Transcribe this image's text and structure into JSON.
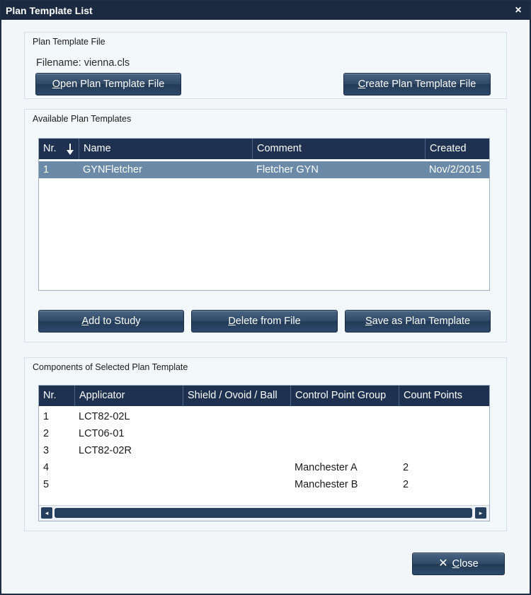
{
  "window": {
    "title": "Plan Template List",
    "close_glyph": "×"
  },
  "file_section": {
    "title": "Plan Template File",
    "filename_label": "Filename: vienna.cls",
    "open_button": {
      "mnemonic": "O",
      "rest": "pen Plan Template File"
    },
    "create_button": {
      "mnemonic": "C",
      "rest": "reate Plan Template File"
    }
  },
  "available_section": {
    "title": "Available Plan Templates",
    "columns": [
      "Nr.",
      "Name",
      "Comment",
      "Created"
    ],
    "sort_icon": "sort-descending-arrow",
    "rows": [
      {
        "nr": "1",
        "name": "GYNFletcher",
        "comment": "Fletcher GYN",
        "created": "Nov/2/2015",
        "selected": true
      }
    ],
    "add_button": {
      "mnemonic": "A",
      "rest": "dd to Study"
    },
    "delete_button": {
      "mnemonic": "D",
      "rest": "elete from File"
    },
    "save_button": {
      "mnemonic": "S",
      "rest": "ave as Plan Template"
    }
  },
  "components_section": {
    "title": "Components of Selected Plan Template",
    "columns": [
      "Nr.",
      "Applicator",
      "Shield / Ovoid / Ball",
      "Control Point Group",
      "Count Points"
    ],
    "rows": [
      {
        "nr": "1",
        "applicator": "LCT82-02L",
        "shield": "",
        "cpg": "",
        "count": ""
      },
      {
        "nr": "2",
        "applicator": "LCT06-01",
        "shield": "",
        "cpg": "",
        "count": ""
      },
      {
        "nr": "3",
        "applicator": "LCT82-02R",
        "shield": "",
        "cpg": "",
        "count": ""
      },
      {
        "nr": "4",
        "applicator": "",
        "shield": "",
        "cpg": "Manchester A",
        "count": "2"
      },
      {
        "nr": "5",
        "applicator": "",
        "shield": "",
        "cpg": "Manchester B",
        "count": "2"
      }
    ],
    "scroll_left_glyph": "◂",
    "scroll_right_glyph": "▸"
  },
  "footer": {
    "close_icon_glyph": "✕",
    "close_button": {
      "mnemonic": "C",
      "rest": "lose"
    }
  },
  "colors": {
    "title_bar": "#1b2a41",
    "header": "#1e3150",
    "selected_row": "#6b8aa8",
    "button": "#2f4966"
  }
}
